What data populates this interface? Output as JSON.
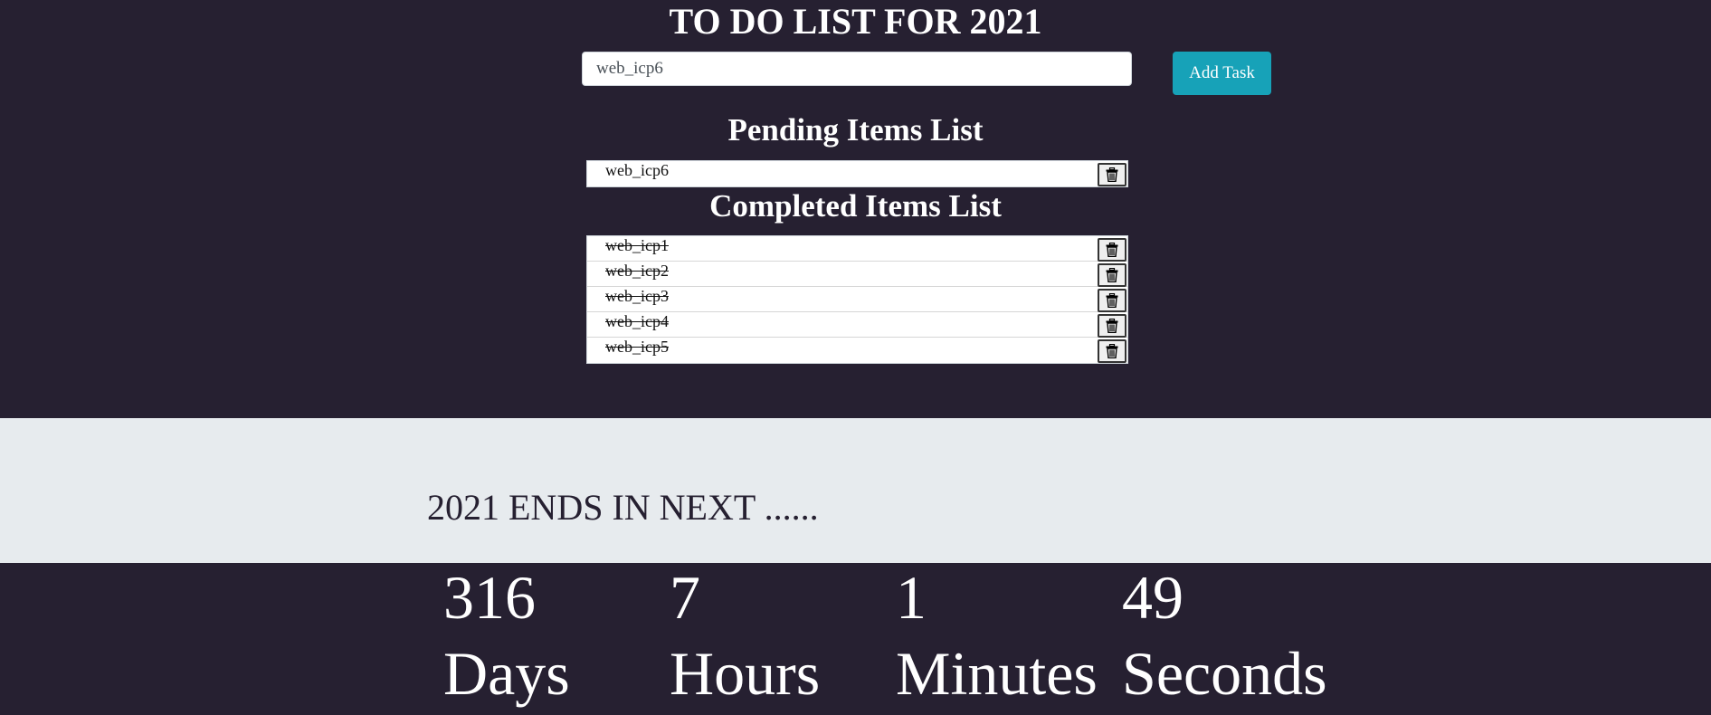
{
  "todo": {
    "title": "TO DO LIST FOR 2021",
    "input_value": "web_icp6",
    "add_button_label": "Add Task",
    "pending_heading": "Pending Items List",
    "completed_heading": "Completed Items List",
    "pending_items": [
      {
        "text": "web_icp6",
        "delete_icon": "trash-icon"
      }
    ],
    "completed_items": [
      {
        "text": "web_icp1",
        "delete_icon": "trash-icon"
      },
      {
        "text": "web_icp2",
        "delete_icon": "trash-icon"
      },
      {
        "text": "web_icp3",
        "delete_icon": "trash-icon"
      },
      {
        "text": "web_icp4",
        "delete_icon": "trash-icon"
      },
      {
        "text": "web_icp5",
        "delete_icon": "trash-icon"
      }
    ]
  },
  "banner": {
    "text": "2021 ENDS IN NEXT ......"
  },
  "countdown": [
    {
      "value": "316",
      "label": "Days"
    },
    {
      "value": "7",
      "label": "Hours"
    },
    {
      "value": "1",
      "label": "Minutes"
    },
    {
      "value": "49",
      "label": "Seconds"
    }
  ],
  "colors": {
    "background": "#262031",
    "banner_background": "#e7ebee",
    "accent": "#17a2b8",
    "text_light": "#ffffff",
    "text_dark": "#262031"
  }
}
